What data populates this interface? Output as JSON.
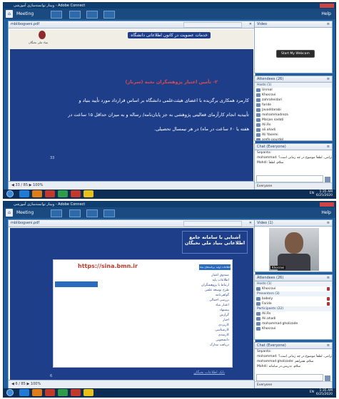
{
  "app": {
    "window_title": "وبینار توانمندسازی آموزشی - Adobe Connect",
    "menu_meeting": "Meeting",
    "menu_help": "Help",
    "clock_time": "1:35 AM",
    "clock_date": "6/25/2020",
    "tray_lang": "EN",
    "status_left": "Connected"
  },
  "frame1": {
    "share_title": "mblibogseni.pdf",
    "share_tools_label": "Draw | Sync | Stop sharing",
    "slide": {
      "header_text": "خدمات عضویت در کانون اطلاعاتی دانشگاه",
      "logo_caption": "بنیاد ملی نخبگان",
      "heading": "۲- تأمین اعتبار پژوهشگران نخبه (سرباز)",
      "body_line1": "کارمرد همکاری برگزیده با اعضای هیئت‌علمی دانشگاه بر اساس قرارداد مورد تأیید بنیاد  و",
      "body_line2": "تأییدیه انجام کارآزمای فعالیتی پژوهشی به جز پایان‌نامه/ رساله و به میزان حداقل ۱۵ ساعت در",
      "body_line3": "هفته یا ۶۰ ساعت در ماه) در هر نیمسال تحصیلی.",
      "page_number": "33"
    },
    "page_indicator": "33 / 85",
    "zoom": "100%",
    "video_title": "Video",
    "video_button": "Start My Webcam",
    "attendees_title": "Attendees (26)",
    "hosts_header": "Hosts (1)",
    "attendees": [
      "Unreal",
      "Khosravi",
      "zahraheidari",
      "faride",
      "Javaddarabi",
      "mohammadreza",
      "Marjan sadati",
      "Ali.Rs",
      "ali.ahadi",
      "Ali Yasemi",
      "arefe pourdel"
    ],
    "chat_title": "Chat (Everyone)",
    "chat_messages": [
      "Sepanta:",
      "mohammad: ضمیر گرامی، لطفاً موضوع در چه زمانی است؟",
      "Mahdi: سلام، لطفاً"
    ],
    "chat_footer": "Everyone"
  },
  "frame2": {
    "share_title": "mblibogseni.pdf",
    "share_tools_label": "Draw | Sync | Stop sharing",
    "slide": {
      "title_line1": "آشنایی با سامانه جامع",
      "title_line2": "اطلاعاتی بنیاد ملی نخبگان",
      "url": "https://sina.bmn.ir",
      "menu_items": [
        "اطلاعات اولیه",
        "برنامه‌های بنیاد",
        "ثبت درخواست",
        "سوابق"
      ],
      "list_items": [
        "صندوق اعتبار",
        "اطلاعات پایه",
        "ارتباط با پژوهشگران",
        "طرح توسعه علمی",
        "گواهی‌نامه",
        "بررسی اجمالی",
        "اعتبار بنیاد",
        "پیشنهاد",
        "گزارش",
        "اخبار",
        "کاربردی",
        "کارشناسی",
        "کارمندی",
        "دانشجویی",
        "دریافت مدارک"
      ],
      "footer_link": "بانک اطلاعات نخبگان",
      "page_number": "6"
    },
    "page_indicator": "6 / 85",
    "zoom": "100%",
    "video_title": "Video (1)",
    "video_caption": "Khosravi",
    "attendees_title": "Attendees (26)",
    "hosts_header": "Hosts (1)",
    "hosts": [
      "Khosravi"
    ],
    "presenters_header": "Presenters (3)",
    "presenters": [
      "baboly",
      "Faride"
    ],
    "participants_header": "Participants (22)",
    "participants": [
      "Ali.Rs",
      "Ali.ahadi",
      "mohammad gholizade",
      "Khosravi"
    ],
    "chat_title": "Chat (Everyone)",
    "chat_messages": [
      "Sepanta:",
      "mohammad: ضمیر گرامی، لطفاً موضوع در چه زمانی است؟",
      "mohammad gholizade: سلام، همراهم",
      "Mahdi: سلام، تدریس در سامانه"
    ],
    "chat_footer": "Everyone"
  },
  "icons": {
    "room_logo": "room-logo-icon",
    "start_button": "windows-start-icon"
  },
  "colors": {
    "frame_blue": "#1f5f9e",
    "slide_blue": "#1e3e8a",
    "accent_red": "#cc3333"
  }
}
